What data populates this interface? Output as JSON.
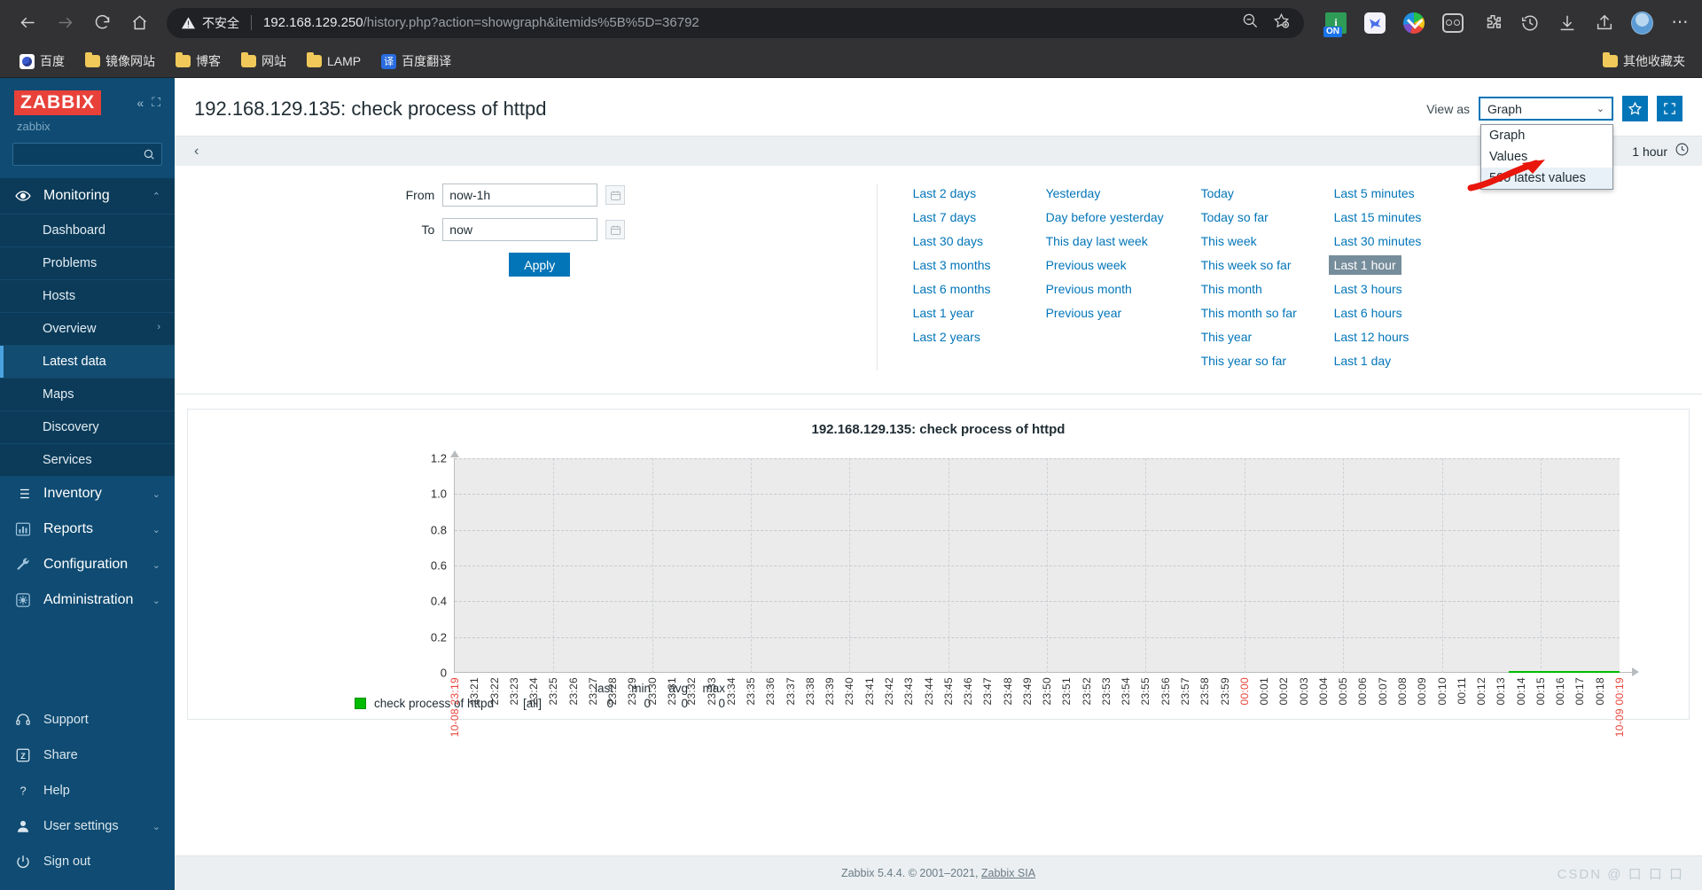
{
  "browser": {
    "back_icon": "back-arrow-icon",
    "forward_icon": "forward-arrow-icon",
    "reload_icon": "reload-icon",
    "home_icon": "home-icon",
    "security_label": "不安全",
    "url_host": "192.168.129.250",
    "url_path": "/history.php?action=showgraph&itemids%5B%5D=36792",
    "zoom_out_icon": "zoom-out-icon",
    "bookmark_star_icon": "add-bookmark-icon",
    "extensions": [
      {
        "name": "ublock-on-extension-icon",
        "label": "ON",
        "glyph": "i"
      },
      {
        "name": "blue-bird-extension-icon"
      },
      {
        "name": "idm-download-extension-icon"
      },
      {
        "name": "oo-extension-icon"
      }
    ],
    "profile_icon": "profile-avatar",
    "history_icon": "history-icon",
    "download_icon": "download-icon",
    "share_icon": "share-icon",
    "menu_icon": "browser-menu-icon",
    "bookmarks": [
      {
        "label": "百度",
        "icon": "baidu-favicon"
      },
      {
        "label": "镜像网站",
        "icon": "folder-icon"
      },
      {
        "label": "博客",
        "icon": "folder-icon"
      },
      {
        "label": "网站",
        "icon": "folder-icon"
      },
      {
        "label": "LAMP",
        "icon": "folder-icon"
      },
      {
        "label": "百度翻译",
        "icon": "fanyi-favicon"
      }
    ],
    "other_bookmarks": {
      "label": "其他收藏夹",
      "icon": "folder-icon"
    }
  },
  "sidebar": {
    "logo": "ZABBIX",
    "server_name": "zabbix",
    "collapse_icon": "collapse-icon",
    "hide_icon": "hide-sidebar-icon",
    "search_placeholder": "",
    "search_value": "",
    "search_icon": "search-icon",
    "groups": [
      {
        "label": "Monitoring",
        "icon": "eye-icon",
        "expanded": true,
        "items": [
          {
            "label": "Dashboard",
            "selected": false
          },
          {
            "label": "Problems",
            "selected": false
          },
          {
            "label": "Hosts",
            "selected": false
          },
          {
            "label": "Overview",
            "selected": false,
            "submenu": true
          },
          {
            "label": "Latest data",
            "selected": true
          },
          {
            "label": "Maps",
            "selected": false
          },
          {
            "label": "Discovery",
            "selected": false
          },
          {
            "label": "Services",
            "selected": false
          }
        ]
      }
    ],
    "flat_items": [
      {
        "label": "Inventory",
        "icon": "list-icon"
      },
      {
        "label": "Reports",
        "icon": "bar-chart-icon"
      },
      {
        "label": "Configuration",
        "icon": "wrench-icon"
      },
      {
        "label": "Administration",
        "icon": "gear-icon"
      }
    ],
    "bottom_items": [
      {
        "label": "Support",
        "icon": "headset-icon"
      },
      {
        "label": "Share",
        "icon": "zabbix-share-icon"
      },
      {
        "label": "Help",
        "icon": "question-icon"
      },
      {
        "label": "User settings",
        "icon": "user-icon"
      },
      {
        "label": "Sign out",
        "icon": "power-icon"
      }
    ]
  },
  "header": {
    "title": "192.168.129.135: check process of httpd",
    "view_as_label": "View as",
    "view_as_selected": "Graph",
    "view_as_options": [
      {
        "label": "Graph",
        "highlighted": false
      },
      {
        "label": "Values",
        "highlighted": false
      },
      {
        "label": "500 latest values",
        "highlighted": true
      }
    ],
    "favorite_icon": "star-icon",
    "kiosk_icon": "fullscreen-icon"
  },
  "filter": {
    "collapse_icon": "chevron-left-icon",
    "range_label": "1 hour",
    "clock_icon": "clock-icon",
    "from_label": "From",
    "from_value": "now-1h",
    "to_label": "To",
    "to_value": "now",
    "calendar_icon": "calendar-icon",
    "apply_label": "Apply",
    "presets_col1": [
      "Last 2 days",
      "Last 7 days",
      "Last 30 days",
      "Last 3 months",
      "Last 6 months",
      "Last 1 year",
      "Last 2 years"
    ],
    "presets_col2": [
      "Yesterday",
      "Day before yesterday",
      "This day last week",
      "Previous week",
      "Previous month",
      "Previous year"
    ],
    "presets_col3": [
      "Today",
      "Today so far",
      "This week",
      "This week so far",
      "This month",
      "This month so far",
      "This year",
      "This year so far"
    ],
    "presets_col4": [
      "Last 5 minutes",
      "Last 15 minutes",
      "Last 30 minutes",
      "Last 1 hour",
      "Last 3 hours",
      "Last 6 hours",
      "Last 12 hours",
      "Last 1 day"
    ],
    "active_preset": "Last 1 hour"
  },
  "chart_data": {
    "type": "line",
    "title": "192.168.129.135: check process of httpd",
    "xlabel": "",
    "ylabel": "",
    "ylim": [
      0,
      1.2
    ],
    "yticks": [
      "0",
      "0.2",
      "0.4",
      "0.6",
      "0.8",
      "1.0",
      "1.2"
    ],
    "grid": true,
    "x_start_label": "10-08 23:19",
    "x_end_label": "10-09 00:19",
    "xticks": [
      "10-08 23:19",
      "23:21",
      "23:22",
      "23:23",
      "23:24",
      "23:25",
      "23:26",
      "23:27",
      "23:28",
      "23:29",
      "23:30",
      "23:31",
      "23:32",
      "23:33",
      "23:34",
      "23:35",
      "23:36",
      "23:37",
      "23:38",
      "23:39",
      "23:40",
      "23:41",
      "23:42",
      "23:43",
      "23:44",
      "23:45",
      "23:46",
      "23:47",
      "23:48",
      "23:49",
      "23:50",
      "23:51",
      "23:52",
      "23:53",
      "23:54",
      "23:55",
      "23:56",
      "23:57",
      "23:58",
      "23:59",
      "00:00",
      "00:01",
      "00:02",
      "00:03",
      "00:04",
      "00:05",
      "00:06",
      "00:07",
      "00:08",
      "00:09",
      "00:10",
      "00:11",
      "00:12",
      "00:13",
      "00:14",
      "00:15",
      "00:16",
      "00:17",
      "00:18",
      "10-09 00:19"
    ],
    "red_xticks": [
      "10-08 23:19",
      "00:00",
      "10-09 00:19"
    ],
    "series": [
      {
        "name": "check process of httpd",
        "color": "#00bb00",
        "scope": "[all]",
        "last": "0",
        "min": "0",
        "avg": "0",
        "max": "0",
        "data_start_fraction": 0.905,
        "values": [
          0,
          0
        ]
      }
    ],
    "legend_headers": [
      "last",
      "min",
      "avg",
      "max"
    ]
  },
  "footer": {
    "text": "Zabbix 5.4.4. © 2001–2021, ",
    "link": "Zabbix SIA",
    "watermark": "CSDN @ 口 口 口"
  }
}
